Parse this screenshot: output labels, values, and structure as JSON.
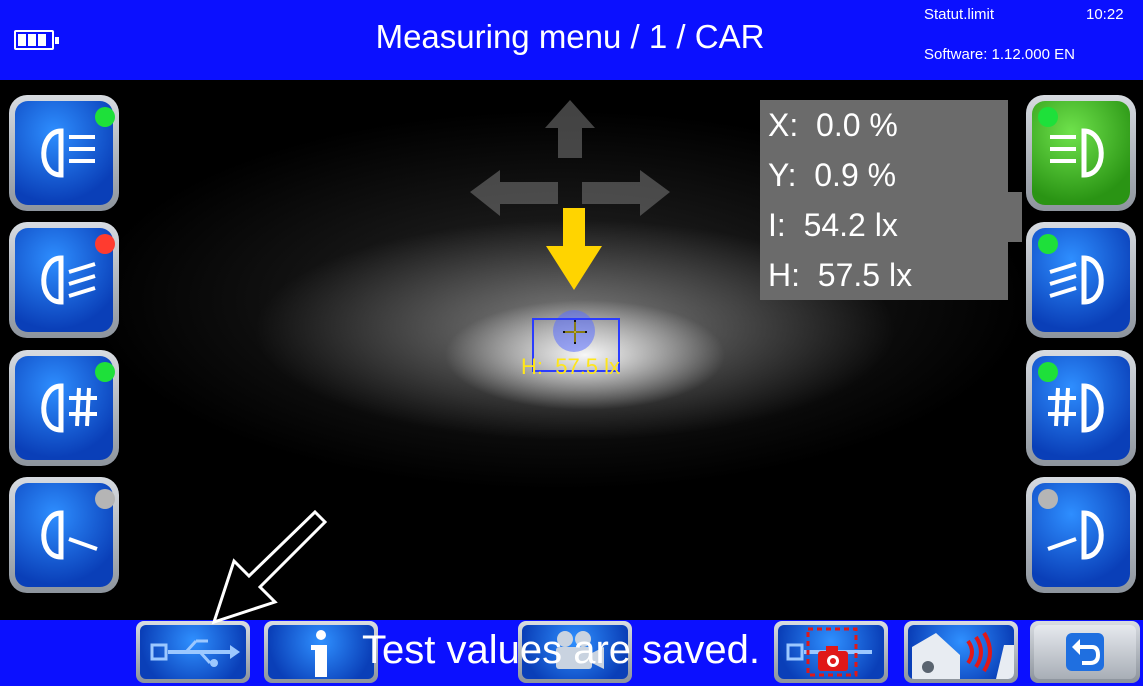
{
  "header": {
    "title": "Measuring menu / 1 / CAR",
    "status": "Statut.limit",
    "time": "10:22",
    "software": "Software: 1.12.000 EN",
    "battery_icon": "battery-icon"
  },
  "readout": {
    "x": "X:  0.0 %",
    "y": "Y:  0.9 %",
    "i": "I:  54.2 lx",
    "h": "H:  57.5 lx"
  },
  "target": {
    "label": "H:  57.5 lx"
  },
  "direction_hint": "down",
  "left_buttons": [
    {
      "icon": "low-beam-icon",
      "led": "#1ee03a"
    },
    {
      "icon": "high-beam-icon",
      "led": "#ff3b2f"
    },
    {
      "icon": "fog-light-icon",
      "led": "#1ee03a"
    },
    {
      "icon": "single-beam-icon",
      "led": "#b5b5b5"
    }
  ],
  "right_buttons": [
    {
      "icon": "low-beam-right-icon",
      "led": "#1ee03a",
      "active": true
    },
    {
      "icon": "high-beam-right-icon",
      "led": "#1ee03a"
    },
    {
      "icon": "fog-light-right-icon",
      "led": "#1ee03a"
    },
    {
      "icon": "single-beam-right-icon",
      "led": "#b5b5b5"
    }
  ],
  "footer": {
    "message": "Test values are saved.",
    "buttons": [
      "usb-icon",
      "info-icon",
      "video-camera-icon",
      "camera-icon",
      "car-signal-icon",
      "back-icon"
    ]
  },
  "colors": {
    "bar": "#0b10ff",
    "accent_yellow": "#ffd400",
    "readout_bg": "#6b6b6b"
  }
}
